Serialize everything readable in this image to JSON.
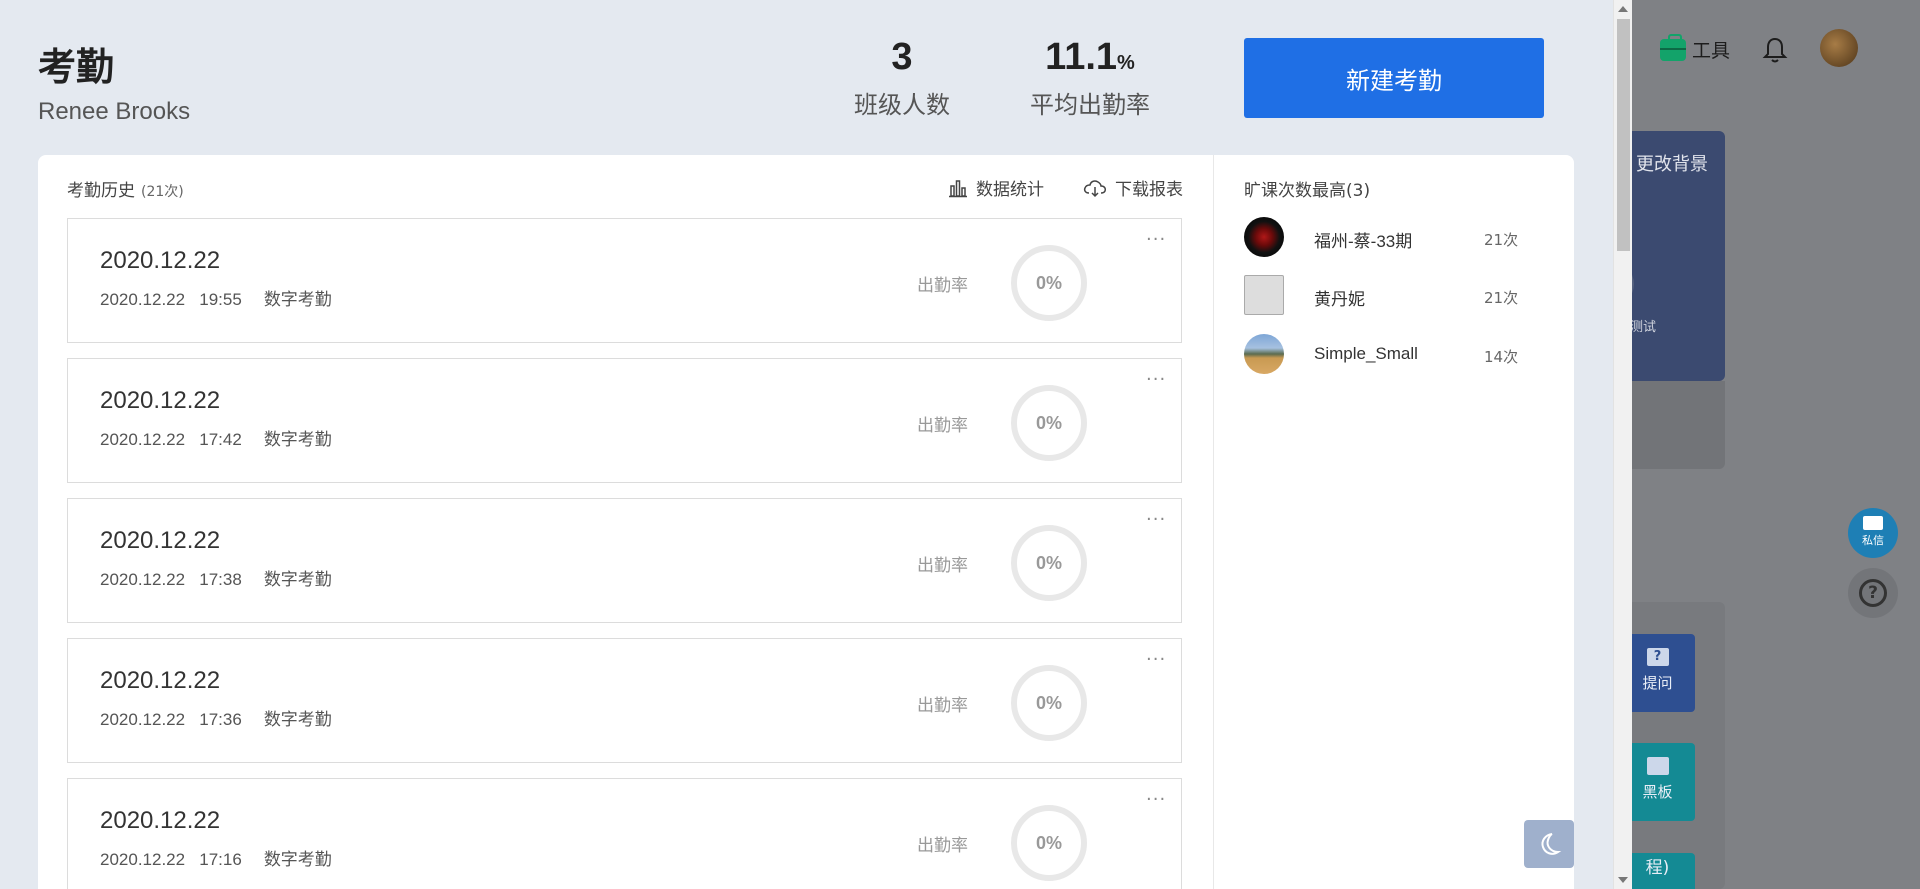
{
  "background_app": {
    "tool_label": "工具",
    "change_bg_label": "更改背景",
    "card_text": "测试",
    "mail_label": "私信",
    "help_label": "?",
    "tiles": {
      "ask": "提问",
      "board": "黑板",
      "course": "程)"
    }
  },
  "header": {
    "title": "考勤",
    "teacher": "Renee Brooks",
    "class_count": {
      "value": "3",
      "label": "班级人数"
    },
    "avg_rate": {
      "value": "11.1",
      "unit": "%",
      "label": "平均出勤率"
    },
    "new_button": "新建考勤"
  },
  "history": {
    "title": "考勤历史",
    "count": "(21次)",
    "stats_link": "数据统计",
    "download_link": "下载报表",
    "records": [
      {
        "date": "2020.12.22",
        "meta_date": "2020.12.22",
        "time": "19:55",
        "type": "数字考勤",
        "rate_label": "出勤率",
        "rate": "0%"
      },
      {
        "date": "2020.12.22",
        "meta_date": "2020.12.22",
        "time": "17:42",
        "type": "数字考勤",
        "rate_label": "出勤率",
        "rate": "0%"
      },
      {
        "date": "2020.12.22",
        "meta_date": "2020.12.22",
        "time": "17:38",
        "type": "数字考勤",
        "rate_label": "出勤率",
        "rate": "0%"
      },
      {
        "date": "2020.12.22",
        "meta_date": "2020.12.22",
        "time": "17:36",
        "type": "数字考勤",
        "rate_label": "出勤率",
        "rate": "0%"
      },
      {
        "date": "2020.12.22",
        "meta_date": "2020.12.22",
        "time": "17:16",
        "type": "数字考勤",
        "rate_label": "出勤率",
        "rate": "0%"
      }
    ],
    "more_label": "···"
  },
  "absence": {
    "title": "旷课次数最高(3)",
    "students": [
      {
        "name": "福州-蔡-33期",
        "count": "21次"
      },
      {
        "name": "黄丹妮",
        "count": "21次"
      },
      {
        "name": "Simple_Small",
        "count": "14次"
      }
    ]
  },
  "colors": {
    "primary": "#1f6fe5",
    "drawer_bg": "#e4e9f0",
    "ring": "#e8e8e8"
  }
}
